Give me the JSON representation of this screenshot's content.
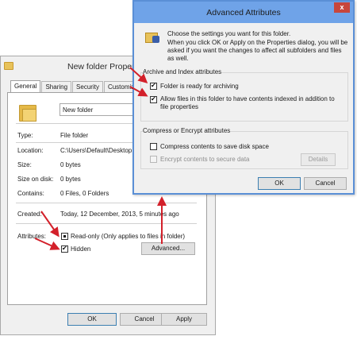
{
  "properties_window": {
    "title": "New folder Properties",
    "tabs": [
      {
        "label": "General",
        "active": true
      },
      {
        "label": "Sharing",
        "active": false
      },
      {
        "label": "Security",
        "active": false
      },
      {
        "label": "Customize",
        "active": false
      }
    ],
    "folder_name": "New folder",
    "rows": [
      {
        "label": "Type:",
        "value": "File folder"
      },
      {
        "label": "Location:",
        "value": "C:\\Users\\Default\\Desktop"
      },
      {
        "label": "Size:",
        "value": "0 bytes"
      },
      {
        "label": "Size on disk:",
        "value": "0 bytes"
      },
      {
        "label": "Contains:",
        "value": "0 Files, 0 Folders"
      },
      {
        "label": "Created:",
        "value": "Today, 12 December, 2013, 5 minutes ago"
      }
    ],
    "attributes_label": "Attributes:",
    "readonly_label": "Read-only (Only applies to files in folder)",
    "readonly_state": "indeterminate",
    "hidden_label": "Hidden",
    "hidden_checked": true,
    "advanced_button": "Advanced...",
    "ok_button": "OK",
    "cancel_button": "Cancel",
    "apply_button": "Apply"
  },
  "advanced_window": {
    "title": "Advanced Attributes",
    "close_glyph": "x",
    "description_line1": "Choose the settings you want for this folder.",
    "description_line2": "When you click OK or Apply on the Properties dialog, you will be asked if you want the changes to affect all subfolders and files as well.",
    "archive_group_label": "Archive and Index attributes",
    "archive_label": "Folder is ready for archiving",
    "archive_checked": true,
    "index_label": "Allow files in this folder to have contents indexed in addition to file properties",
    "index_checked": true,
    "compress_group_label": "Compress or Encrypt attributes",
    "compress_label": "Compress contents to save disk space",
    "compress_checked": false,
    "encrypt_label": "Encrypt contents to secure data",
    "encrypt_checked": false,
    "details_button": "Details",
    "ok_button": "OK",
    "cancel_button": "Cancel"
  },
  "colors": {
    "annotation_arrow": "#d3202a",
    "titlebar_accent": "#6fa3e8"
  }
}
